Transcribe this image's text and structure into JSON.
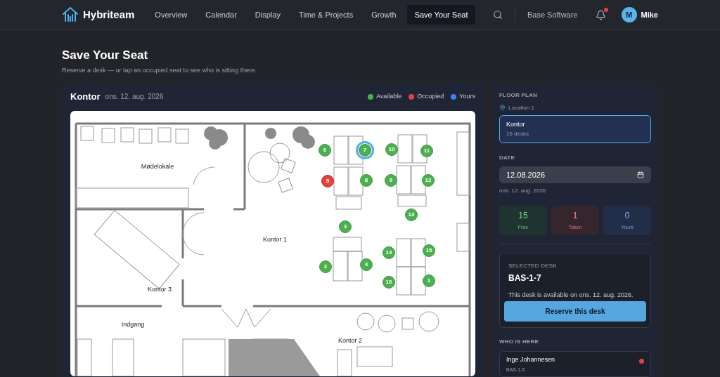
{
  "nav": {
    "brand": "Hybriteam",
    "items": [
      {
        "label": "Overview",
        "selected": false
      },
      {
        "label": "Calendar",
        "selected": false
      },
      {
        "label": "Display",
        "selected": false
      },
      {
        "label": "Time & Projects",
        "selected": false
      },
      {
        "label": "Growth",
        "selected": false
      },
      {
        "label": "Save Your Seat",
        "selected": true
      }
    ],
    "company": "Base Software",
    "notification": true,
    "user": {
      "initial": "M",
      "name": "Mike"
    }
  },
  "page": {
    "title": "Save Your Seat",
    "subtitle": "Reserve a desk — or tap an occupied seat to see who is sitting there."
  },
  "map": {
    "title": "Kontor",
    "date": "ons. 12. aug. 2026",
    "legend": [
      {
        "label": "Available",
        "color": "#4caf50"
      },
      {
        "label": "Occupied",
        "color": "#e0443e"
      },
      {
        "label": "Yours",
        "color": "#3b82f6"
      }
    ],
    "rooms": [
      "Mødelokale",
      "Kontor 1",
      "Kontor 3",
      "Indgang",
      "Kontor 2"
    ],
    "seats": [
      {
        "label": "6",
        "occupied": false,
        "selected": false
      },
      {
        "label": "7",
        "occupied": false,
        "selected": true
      },
      {
        "label": "10",
        "occupied": false,
        "selected": false
      },
      {
        "label": "11",
        "occupied": false,
        "selected": false
      },
      {
        "label": "5",
        "occupied": true,
        "selected": false
      },
      {
        "label": "8",
        "occupied": false,
        "selected": false
      },
      {
        "label": "9",
        "occupied": false,
        "selected": false
      },
      {
        "label": "12",
        "occupied": false,
        "selected": false
      },
      {
        "label": "13",
        "occupied": false,
        "selected": false
      },
      {
        "label": "3",
        "occupied": false,
        "selected": false
      },
      {
        "label": "14",
        "occupied": false,
        "selected": false
      },
      {
        "label": "15",
        "occupied": false,
        "selected": false
      },
      {
        "label": "2",
        "occupied": false,
        "selected": false
      },
      {
        "label": "4",
        "occupied": false,
        "selected": false
      },
      {
        "label": "16",
        "occupied": false,
        "selected": false
      },
      {
        "label": "1",
        "occupied": false,
        "selected": false
      }
    ]
  },
  "side": {
    "floor_plan_heading": "FLOOR PLAN",
    "location": "Location 1",
    "plans": [
      {
        "name": "Kontor",
        "desks": "16 desks",
        "selected": true
      }
    ],
    "date_heading": "DATE",
    "date_value": "12.08.2026",
    "date_text": "ons. 12. aug. 2026",
    "stats": [
      {
        "kind": "free",
        "value": "15",
        "label": "Free"
      },
      {
        "kind": "taken",
        "value": "1",
        "label": "Taken"
      },
      {
        "kind": "yours",
        "value": "0",
        "label": "Yours"
      }
    ],
    "selected_heading": "SELECTED DESK",
    "selected_desk": "BAS-1-7",
    "selected_text": "This desk is available on ons. 12. aug. 2026.",
    "reserve_button": "Reserve this desk",
    "who_heading": "WHO IS HERE",
    "people": [
      {
        "name": "Inge Johannesen",
        "desk": "BAS-1-5",
        "color": "#e0443e"
      }
    ]
  }
}
